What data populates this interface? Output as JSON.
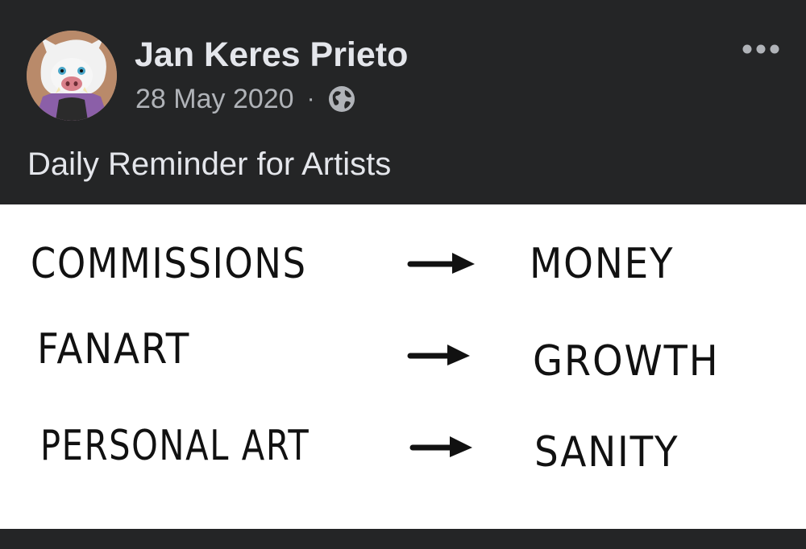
{
  "post": {
    "author": "Jan Keres Prieto",
    "date": "28 May 2020",
    "separator": "·",
    "privacy_icon": "globe-icon",
    "more_icon": "more-horizontal-icon",
    "caption": "Daily Reminder for Artists"
  },
  "image": {
    "rows": [
      {
        "left": "COMMISSIONS",
        "right": "MONEY"
      },
      {
        "left": "FANART",
        "right": "GROWTH"
      },
      {
        "left": "PERSONAL ART",
        "right": "SANITY"
      }
    ]
  },
  "colors": {
    "background": "#242526",
    "primary_text": "#e4e6eb",
    "secondary_text": "#b0b3b8",
    "image_background": "#ffffff",
    "ink": "#111111"
  }
}
